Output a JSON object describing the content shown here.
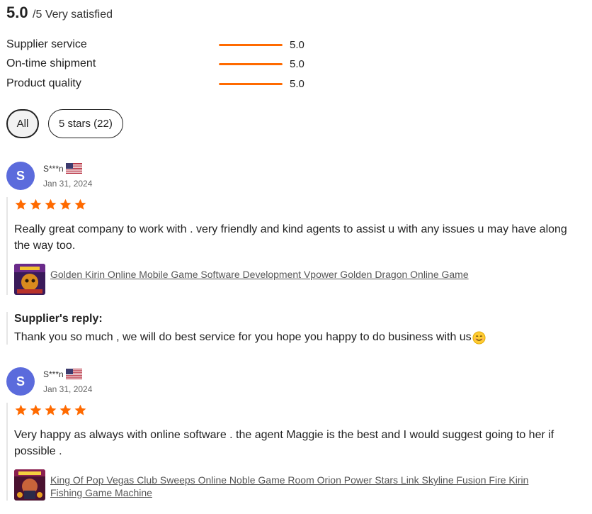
{
  "summary": {
    "score": "5.0",
    "label": "/5 Very satisfied"
  },
  "metrics": [
    {
      "label": "Supplier service",
      "value": "5.0",
      "fraction": 1.0
    },
    {
      "label": "On-time shipment",
      "value": "5.0",
      "fraction": 1.0
    },
    {
      "label": "Product quality",
      "value": "5.0",
      "fraction": 1.0
    }
  ],
  "filters": {
    "all_label": "All",
    "stars_label": "5 stars (22)"
  },
  "reviews": [
    {
      "avatar_letter": "S",
      "reviewer": "S***n",
      "flag_icon": "us-flag-icon",
      "date": "Jan 31, 2024",
      "rating": 5,
      "comment": "Really great company to work with . very friendly and kind agents to assist u with any issues u may have along the way too.",
      "product_link": "Golden Kirin Online Mobile Game Software Development Vpower Golden Dragon Online Game",
      "reply_title": "Supplier's reply:",
      "reply_text": "Thank you so much , we will do best service for you hope you happy to do business with us"
    },
    {
      "avatar_letter": "S",
      "reviewer": "S***n",
      "flag_icon": "us-flag-icon",
      "date": "Jan 31, 2024",
      "rating": 5,
      "comment": "Very happy as always with online software . the agent Maggie is the best and I would suggest going to her if possible .",
      "product_link": "King Of Pop Vegas Club Sweeps Online Noble Game Room Orion Power Stars Link Skyline Fusion Fire Kirin Fishing Game Machine"
    }
  ],
  "colors": {
    "accent": "#ff6a00",
    "avatar": "#5b6bdc",
    "star": "#ff6a00"
  }
}
